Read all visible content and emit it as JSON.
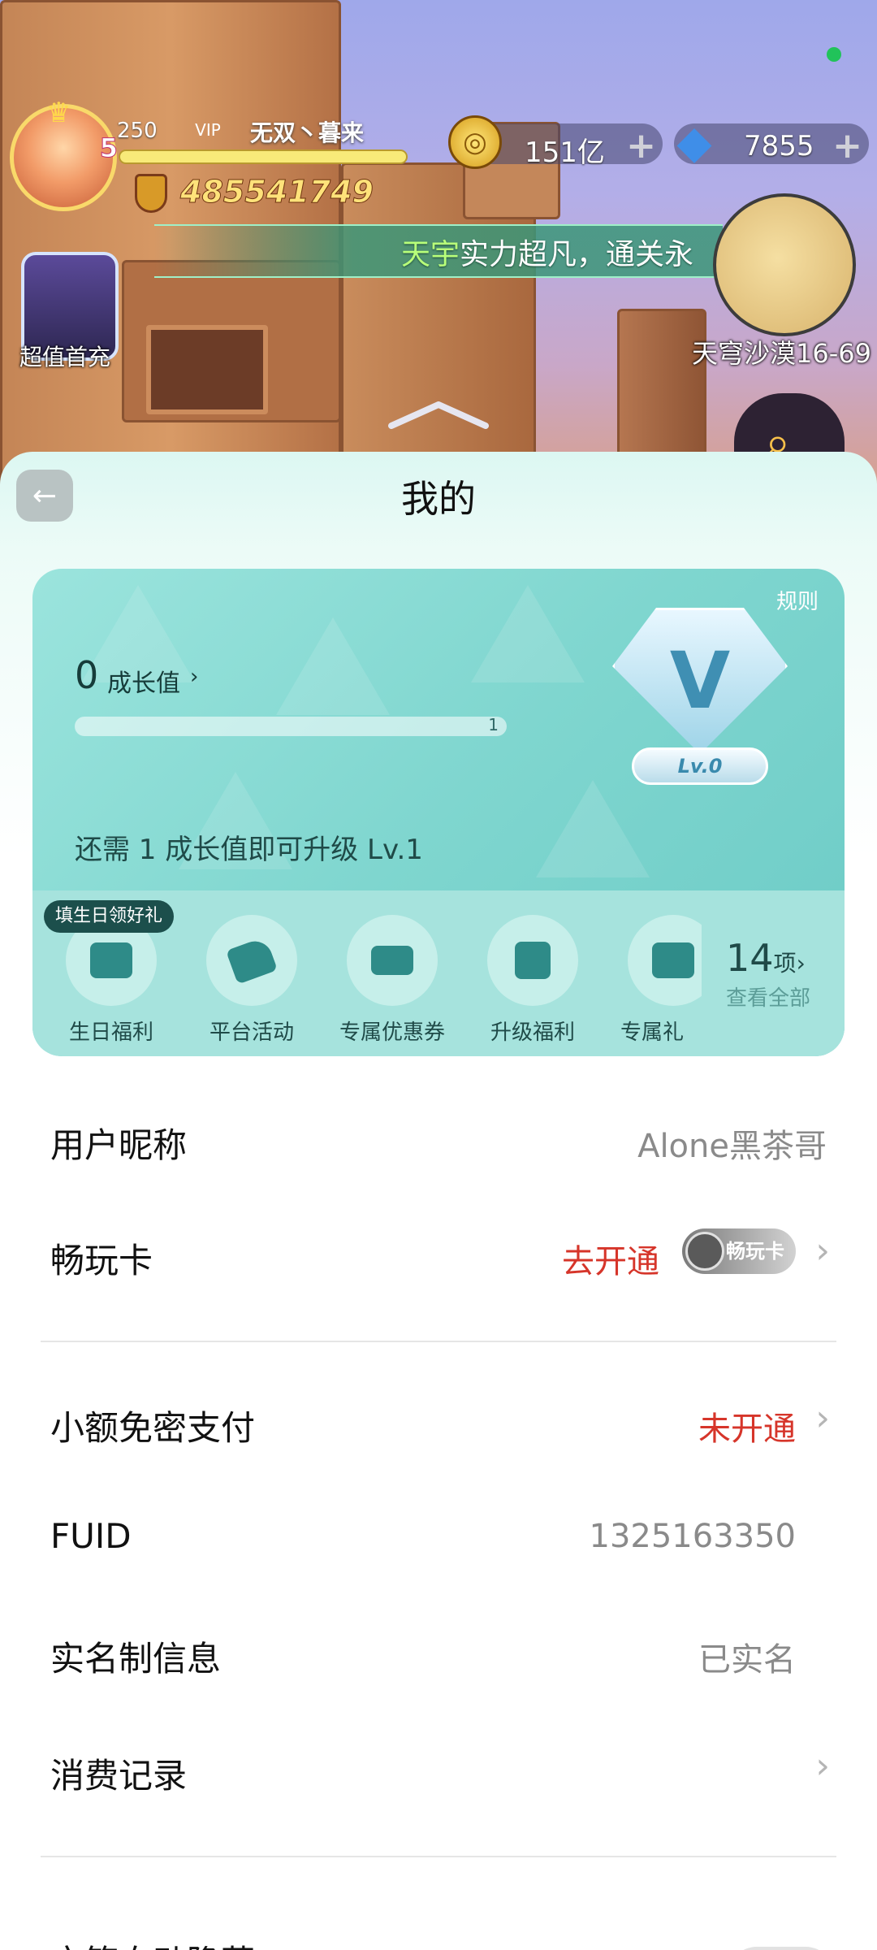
{
  "hud": {
    "player_level": "250",
    "vip_tag": "VIP",
    "player_name": "无双丶暮来",
    "hero_level_badge": "5",
    "power": "485541749",
    "gold": "151亿",
    "gems": "7855",
    "plus_symbol": "+",
    "banner_highlight": "天宇",
    "banner_text": "实力超凡，通关永",
    "minimap_location": "天穹沙漠16-69",
    "char_card_label": "超值首充"
  },
  "sheet": {
    "back_icon": "←",
    "title": "我的"
  },
  "vip_card": {
    "rules": "规则",
    "growth_value": "0",
    "growth_label": "成长值",
    "growth_arrow": "›",
    "progress_end_label": "1",
    "progress_fraction": 0.0,
    "badge_letter": "V",
    "badge_level": "Lv.0",
    "upgrade_hint": "还需 1 成长值即可升级 Lv.1",
    "benefit_tag": "填生日领好礼",
    "benefits": [
      {
        "label": "生日福利",
        "icon": "birthday-gift-icon"
      },
      {
        "label": "平台活动",
        "icon": "tag-icon"
      },
      {
        "label": "专属优惠券",
        "icon": "coupon-icon"
      },
      {
        "label": "升级福利",
        "icon": "upgrade-icon"
      },
      {
        "label": "专属礼",
        "icon": "gift-icon"
      }
    ],
    "benefit_count": "14",
    "benefit_unit": "项",
    "benefit_arrow": "›",
    "view_all": "查看全部"
  },
  "settings": {
    "nickname_label": "用户昵称",
    "nickname_value": "Alone黑茶哥",
    "pass_label": "畅玩卡",
    "pass_value": "去开通",
    "pass_badge": "畅玩卡",
    "small_pay_label": "小额免密支付",
    "small_pay_value": "未开通",
    "fuid_label": "FUID",
    "fuid_value": "1325163350",
    "realname_label": "实名制信息",
    "realname_value": "已实名",
    "purchase_label": "消费记录",
    "chest_label": "宝箱自动隐藏",
    "chevron": "›"
  },
  "colors": {
    "accent_red": "#d6352a",
    "card_teal": "#7fd6cf",
    "online_green": "#21c35a"
  }
}
